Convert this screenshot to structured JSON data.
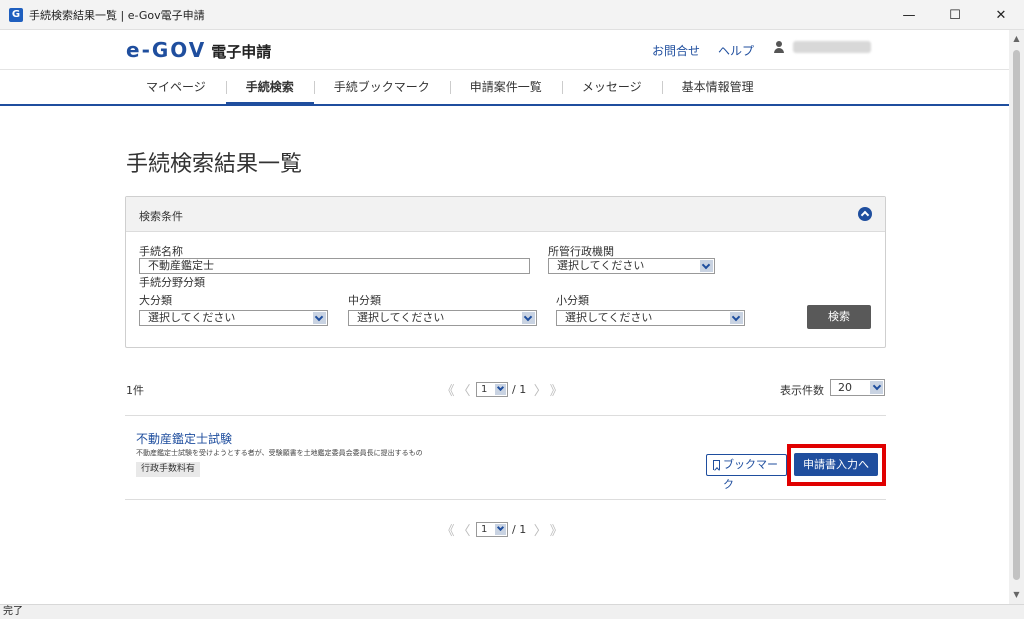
{
  "window": {
    "app_icon": "G",
    "title": "手続検索結果一覧 | e-Gov電子申請",
    "minimize": "—",
    "maximize": "☐",
    "close": "✕"
  },
  "header": {
    "logo_mark": "e-GOV",
    "logo_sub": "電子申請",
    "links": {
      "contact": "お問合せ",
      "help": "ヘルプ"
    }
  },
  "nav": {
    "items": [
      {
        "label": "マイページ"
      },
      {
        "label": "手続検索"
      },
      {
        "label": "手続ブックマーク"
      },
      {
        "label": "申請案件一覧"
      },
      {
        "label": "メッセージ"
      },
      {
        "label": "基本情報管理"
      }
    ]
  },
  "page": {
    "title": "手続検索結果一覧"
  },
  "search": {
    "panel_title": "検索条件",
    "procedure_name_label": "手続名称",
    "procedure_name_value": "不動産鑑定士",
    "agency_label": "所管行政機関",
    "agency_value": "選択してください",
    "category_label": "手続分野分類",
    "large_label": "大分類",
    "large_value": "選択してください",
    "medium_label": "中分類",
    "medium_value": "選択してください",
    "small_label": "小分類",
    "small_value": "選択してください",
    "search_button": "検索"
  },
  "results": {
    "count": "1件",
    "pager": {
      "first": "《",
      "prev": "〈",
      "page": "1",
      "total": "/ 1",
      "next": "〉",
      "last": "》"
    },
    "per_page_label": "表示件数",
    "per_page_value": "20",
    "items": [
      {
        "title": "不動産鑑定士試験",
        "description": "不動産鑑定士試験を受けようとする者が、受験願書を土地鑑定委員会委員長に提出するもの",
        "tag": "行政手数料有",
        "bookmark_button": "ブックマーク",
        "apply_button": "申請書入力へ"
      }
    ]
  },
  "status_bar": {
    "text": "完了"
  },
  "colors": {
    "brand": "#1f4e9e",
    "highlight": "#e00000"
  }
}
